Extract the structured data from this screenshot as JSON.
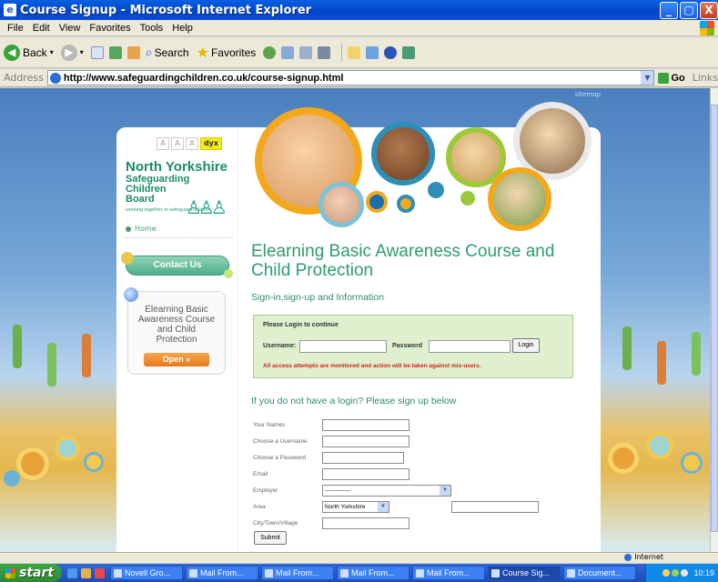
{
  "window": {
    "title": "Course Signup - Microsoft Internet Explorer",
    "ie_logo": "e",
    "buttons": {
      "minimize": "_",
      "maximize": "▢",
      "close": "X"
    }
  },
  "menu": [
    "File",
    "Edit",
    "View",
    "Favorites",
    "Tools",
    "Help"
  ],
  "toolbar": {
    "back": "Back",
    "search": "Search",
    "favorites": "Favorites"
  },
  "address": {
    "label": "Address",
    "url": "http://www.safeguardingchildren.co.uk/course-signup.html",
    "go": "Go",
    "links": "Links"
  },
  "page": {
    "sitemap": "sitemap",
    "font_sizes": [
      "A",
      "A",
      "A"
    ],
    "dyx": "dyx",
    "logo": {
      "line1": "North Yorkshire",
      "line2": "Safeguarding",
      "line3": "Children",
      "line4": "Board",
      "tagline": "working together to safeguard children"
    },
    "home": "Home",
    "contact_us": "Contact Us",
    "course_box": {
      "text": "Elearning Basic Awareness Course and Child Protection",
      "open": "Open »"
    },
    "heading": "Elearning Basic Awareness Course and Child Protection",
    "subheading": "Sign-in,sign-up and Information",
    "login": {
      "prompt": "Please Login to continue",
      "username_label": "Username:",
      "password_label": "Password",
      "login_button": "Login",
      "warning": "All access attempts are monitored and action will be taken against mis-users."
    },
    "signup_heading": "If you do not have a login? Please sign up below",
    "form": {
      "your_names": "Your Names",
      "username": "Choose a Username",
      "password": "Choose a Password",
      "email": "Email",
      "employer": "Employer",
      "employer_value": "-------------",
      "area": "Area",
      "area_value": "North Yorkshire",
      "city": "City/Town/Village",
      "submit": "Submit"
    }
  },
  "status": {
    "zone": "Internet"
  },
  "taskbar": {
    "start": "start",
    "tasks": [
      "Novell Gro...",
      "Mail From...",
      "Mail From...",
      "Mail From...",
      "Mail From...",
      "Course Sig...",
      "Document..."
    ],
    "active_task_index": 5,
    "clock": "10:19"
  },
  "colors": {
    "brand_green": "#2f9b6f",
    "warning_red": "#d02020",
    "xp_blue": "#2456c5"
  }
}
